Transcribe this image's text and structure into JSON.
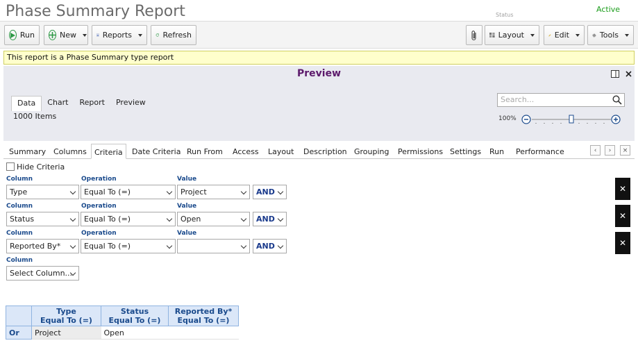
{
  "header": {
    "title": "Phase Summary Report",
    "status_label": "Status",
    "status_value": "Active"
  },
  "toolbar": {
    "run": "Run",
    "new": "New",
    "reports": "Reports",
    "refresh": "Refresh",
    "layout": "Layout",
    "edit": "Edit",
    "tools": "Tools"
  },
  "banner": "This report is a Phase Summary type report",
  "preview": {
    "title": "Preview",
    "tabs": [
      "Data",
      "Chart",
      "Report",
      "Preview"
    ],
    "item_count": "1000 Items",
    "search_placeholder": "Search...",
    "zoom": "100%",
    "zoom_fraction": 0.5
  },
  "tabs": [
    "Summary",
    "Columns",
    "Criteria",
    "Date Criteria",
    "Run From",
    "Access",
    "Layout",
    "Description",
    "Grouping",
    "Permissions",
    "Settings",
    "Run",
    "Performance"
  ],
  "active_tab": "Criteria",
  "criteria": {
    "hide_label": "Hide Criteria",
    "column_label": "Column",
    "operation_label": "Operation",
    "value_label": "Value",
    "rows": [
      {
        "column": "Type",
        "operation": "Equal To (=)",
        "value": "Project",
        "conj": "AND"
      },
      {
        "column": "Status",
        "operation": "Equal To (=)",
        "value": "Open",
        "conj": "AND"
      },
      {
        "column": "Reported By*",
        "operation": "Equal To (=)",
        "value": "",
        "conj": "AND"
      }
    ],
    "new_column_placeholder": "Select Column..."
  },
  "grid": {
    "headers": [
      {
        "line1": "Type",
        "line2": "Equal To (=)"
      },
      {
        "line1": "Status",
        "line2": "Equal To (=)"
      },
      {
        "line1": "Reported By*",
        "line2": "Equal To (=)"
      }
    ],
    "rows": [
      {
        "label": "Or",
        "cells": [
          "Project",
          "Open",
          ""
        ]
      }
    ]
  }
}
